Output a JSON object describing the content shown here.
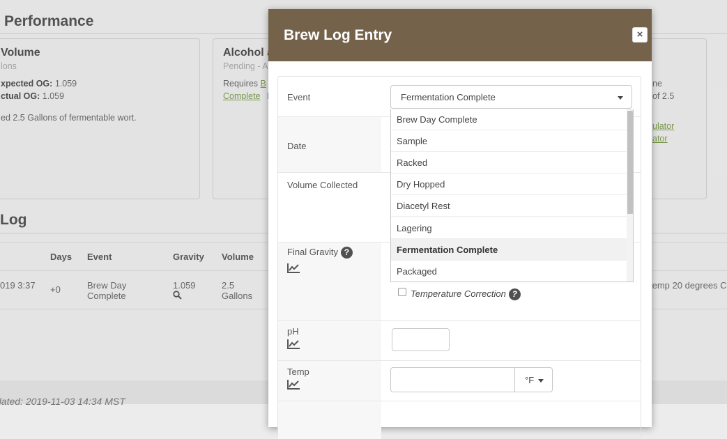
{
  "background": {
    "performance_title": "Performance",
    "volume_card": {
      "title": "Volume",
      "subtitle": "lons",
      "expected_og_label": "xpected OG:",
      "expected_og_value": "1.059",
      "actual_og_label": "ctual OG:",
      "actual_og_value": "1.059",
      "note": "ed 2.5 Gallons of fermentable wort."
    },
    "alcohol_card": {
      "title": "Alcohol a",
      "subtitle": "Pending - A",
      "requires_text": "Requires",
      "link_b": "B",
      "link_complete": "Complete",
      "tail": "I"
    },
    "right_card": {
      "line1": "ne",
      "line2": "of 2.5",
      "link1": "ulator",
      "link2": "ator"
    },
    "log_title": "Log",
    "table": {
      "headers": [
        "Days",
        "Event",
        "Gravity",
        "Volume"
      ],
      "row": {
        "date": "019 3:37",
        "days": "+0",
        "event_line1": "Brew Day",
        "event_line2": "Complete",
        "gravity": "1.059",
        "volume_line1": "2.5",
        "volume_line2": "Gallons",
        "right_note": "temp 20 degrees C"
      }
    },
    "footer": "dated: 2019-11-03 14:34 MST"
  },
  "modal": {
    "title": "Brew Log Entry",
    "close_label": "×",
    "labels": {
      "event": "Event",
      "date": "Date",
      "volume_collected": "Volume Collected",
      "final_gravity": "Final Gravity",
      "ph": "pH",
      "temp": "Temp"
    },
    "help_glyph": "?",
    "event_select": {
      "selected": "Fermentation Complete",
      "options": [
        "Brew Day Complete",
        "Sample",
        "Racked",
        "Dry Hopped",
        "Diacetyl Rest",
        "Lagering",
        "Fermentation Complete",
        "Packaged"
      ]
    },
    "temperature_correction_label": "Temperature Correction",
    "temp_unit": "°F",
    "ph_value": "",
    "temp_value": ""
  },
  "colors": {
    "modal_header": "#75624a",
    "link_green": "#7b9a4b"
  }
}
